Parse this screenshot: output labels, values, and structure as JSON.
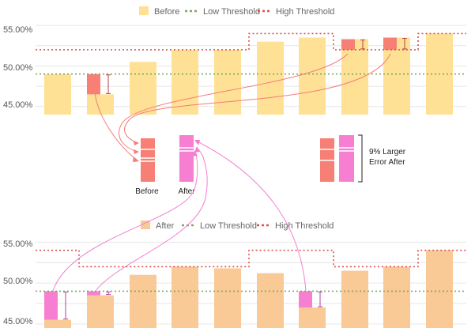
{
  "colors": {
    "before_bar": "#FFE195",
    "after_bar": "#F9C996",
    "low_threshold": "#7FA862",
    "high_threshold": "#D9534F",
    "error_before": "#F77F75",
    "error_after": "#F77FD2",
    "grid": "#e6e6e6",
    "axis_text": "#555555",
    "legend_text": "#666666"
  },
  "chart_data": [
    {
      "type": "bar",
      "legend": [
        "Before",
        "Low Threshold",
        "High Threshold"
      ],
      "legend_position": "top",
      "yticks": [
        "55.00%",
        "50.00%",
        "45.00%"
      ],
      "ylim": [
        44,
        55.6
      ],
      "values": [
        49.0,
        46.5,
        50.5,
        52.0,
        52.0,
        53.0,
        53.5,
        53.3,
        53.5,
        54.0
      ],
      "low_threshold": [
        49.0,
        49.0,
        49.0,
        49.0,
        49.0,
        49.0,
        49.0,
        49.0,
        49.0,
        49.0
      ],
      "high_threshold": [
        52.0,
        52.0,
        52.0,
        52.0,
        52.0,
        54.0,
        54.0,
        52.0,
        52.0,
        54.0
      ],
      "error_segments": [
        {
          "index": 1,
          "from": 46.5,
          "to": 49.0
        },
        {
          "index": 7,
          "from": 52.0,
          "to": 53.3
        },
        {
          "index": 8,
          "from": 52.0,
          "to": 53.5
        }
      ],
      "grid": true
    },
    {
      "type": "bar",
      "legend": [
        "After",
        "Low Threshold",
        "High Threshold"
      ],
      "legend_position": "top",
      "yticks": [
        "55.00%",
        "50.00%",
        "45.00%"
      ],
      "ylim": [
        44.5,
        56
      ],
      "values": [
        45.5,
        48.5,
        51.0,
        52.0,
        51.8,
        51.2,
        47.0,
        51.5,
        52.0,
        54.0
      ],
      "low_threshold": [
        49.0,
        49.0,
        49.0,
        49.0,
        49.0,
        49.0,
        49.0,
        49.0,
        49.0,
        49.0
      ],
      "high_threshold": [
        54.0,
        52.0,
        52.0,
        52.0,
        52.0,
        54.0,
        54.0,
        52.0,
        52.0,
        54.0
      ],
      "error_segments": [
        {
          "index": 0,
          "from": 45.5,
          "to": 49.0
        },
        {
          "index": 1,
          "from": 48.5,
          "to": 49.0
        },
        {
          "index": 6,
          "from": 47.0,
          "to": 49.0
        }
      ],
      "grid": true
    }
  ],
  "middle": {
    "before_label": "Before",
    "after_label": "After",
    "comparison_text_line1": "9% Larger",
    "comparison_text_line2": "Error After"
  }
}
